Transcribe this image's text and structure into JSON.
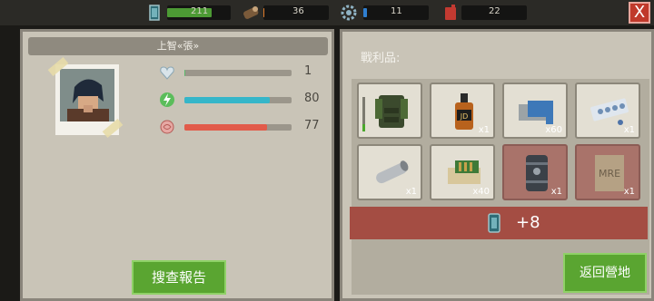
{
  "topbar": {
    "resources": [
      {
        "name": "battery",
        "icon": "battery-icon",
        "value_text": "211",
        "level": 0.7
      },
      {
        "name": "wood",
        "icon": "log-icon",
        "value_text": "36",
        "level": 0.02
      },
      {
        "name": "parts",
        "icon": "gear-icon",
        "value_text": "11",
        "level": 0.05
      },
      {
        "name": "fuel",
        "icon": "fuel-can-icon",
        "value_text": "22",
        "level": 0.0
      }
    ],
    "close_label": "X"
  },
  "survivor": {
    "name": "上智«張»",
    "stats": [
      {
        "icon": "heart-icon",
        "value": "1",
        "level": 0.01,
        "color": "#5bb86b"
      },
      {
        "icon": "energy-icon",
        "value": "80",
        "level": 0.8,
        "color": "#35b6c9"
      },
      {
        "icon": "brain-icon",
        "value": "77",
        "level": 0.77,
        "color": "#e25b4a"
      }
    ],
    "report_button": "搜查報告"
  },
  "loot": {
    "title": "戰利品:",
    "items": [
      {
        "icon": "vest-icon",
        "qty": ""
      },
      {
        "icon": "whiskey-bottle-icon",
        "qty": "x1"
      },
      {
        "icon": "duct-tape-icon",
        "qty": "x60"
      },
      {
        "icon": "pill-pack-icon",
        "qty": "x1"
      },
      {
        "icon": "pipe-icon",
        "qty": "x1"
      },
      {
        "icon": "ammo-box-icon",
        "qty": "x40"
      },
      {
        "icon": "canister-icon",
        "qty": "x1"
      },
      {
        "icon": "mre-pack-icon",
        "qty": "x1"
      }
    ],
    "bonus_icon": "battery-icon",
    "bonus_text": "+8"
  },
  "return_button": "返回營地",
  "colors": {
    "panel": "#c9c4b7",
    "green": "#5aa531",
    "rare_slot": "#a9736a",
    "bonus": "#a44d43"
  }
}
